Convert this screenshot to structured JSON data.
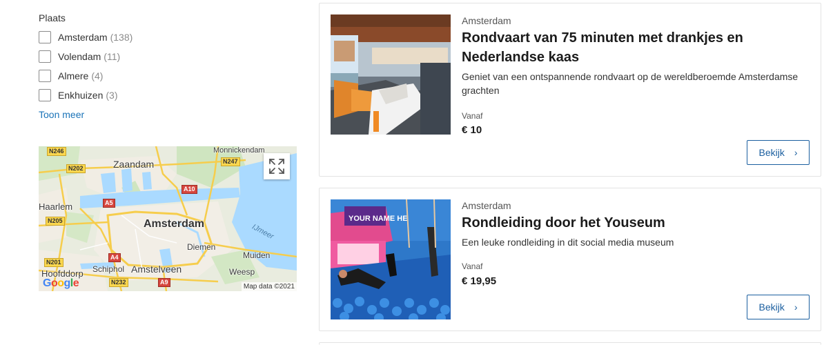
{
  "filter": {
    "title": "Plaats",
    "options": [
      {
        "label": "Amsterdam",
        "count": "(138)"
      },
      {
        "label": "Volendam",
        "count": "(11)"
      },
      {
        "label": "Almere",
        "count": "(4)"
      },
      {
        "label": "Enkhuizen",
        "count": "(3)"
      }
    ],
    "more_label": "Toon meer"
  },
  "map": {
    "expand_icon": "expand-arrows-icon",
    "labels": {
      "zaandam": "Zaandam",
      "amsterdam": "Amsterdam",
      "monnickendam": "Monnickendam",
      "haarlem": "Haarlem",
      "diemen": "Diemen",
      "muiden": "Muiden",
      "schiphol": "Schiphol",
      "amstelveen": "Amstelveen",
      "hoofddorp": "Hoofddorp",
      "weesp": "Weesp",
      "ijmeer": "IJmeer"
    },
    "roads": {
      "n246": "N246",
      "n202": "N202",
      "n247": "N247",
      "a10": "A10",
      "a5": "A5",
      "n205": "N205",
      "n201": "N201",
      "a4": "A4",
      "n232": "N232",
      "a9": "A9"
    },
    "logo": "Google",
    "attribution": "Map data ©2021"
  },
  "cards": [
    {
      "location": "Amsterdam",
      "title": "Rondvaart van 75 minuten met drankjes en Nederlandse kaas",
      "description": "Geniet van een ontspannende rondvaart op de wereldberoemde Amsterdamse grachten",
      "price_prefix": "Vanaf",
      "price": "€ 10",
      "button_label": "Bekijk"
    },
    {
      "location": "Amsterdam",
      "title": "Rondleiding door het Youseum",
      "description": "Een leuke rondleiding in dit social media museum",
      "price_prefix": "Vanaf",
      "price": "€ 19,95",
      "button_label": "Bekijk",
      "image_sign_text": "YOUR NAME HE"
    }
  ],
  "colors": {
    "link": "#1a73b8",
    "button": "#1a5e9f"
  }
}
